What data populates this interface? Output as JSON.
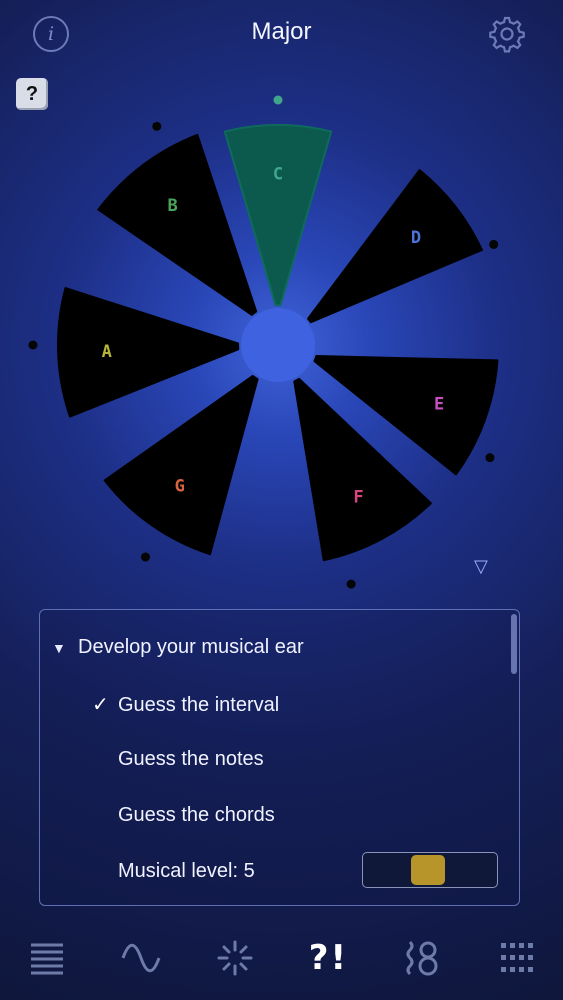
{
  "header": {
    "title": "Major",
    "info_icon_glyph": "i",
    "help_glyph": "?"
  },
  "wheel": {
    "notes": [
      {
        "label": "C",
        "color": "#3fa68c",
        "selected": true,
        "fill": "#0c5a4d"
      },
      {
        "label": "D",
        "color": "#4b73d9",
        "selected": false
      },
      {
        "label": "E",
        "color": "#c94fc0",
        "selected": false
      },
      {
        "label": "F",
        "color": "#d9457f",
        "selected": false
      },
      {
        "label": "G",
        "color": "#d9643e",
        "selected": false
      },
      {
        "label": "A",
        "color": "#b8b43a",
        "selected": false
      },
      {
        "label": "B",
        "color": "#4aa35a",
        "selected": false
      }
    ]
  },
  "panel": {
    "section_title": "Develop your musical ear",
    "options": [
      {
        "label": "Guess the interval",
        "checked": true
      },
      {
        "label": "Guess the notes",
        "checked": false
      },
      {
        "label": "Guess the chords",
        "checked": false
      }
    ],
    "level_label": "Musical level: 5",
    "level_value": 5,
    "level_fraction": 0.5,
    "check_glyph": "✓",
    "section_glyph": "▼"
  },
  "collapse_glyph": "▽",
  "nav": {
    "items": [
      {
        "name": "staff-icon",
        "active": false
      },
      {
        "name": "wave-icon",
        "active": false
      },
      {
        "name": "burst-icon",
        "active": false
      },
      {
        "name": "quiz-icon",
        "label": "?!",
        "active": true
      },
      {
        "name": "tuning-icon",
        "active": false
      },
      {
        "name": "grid-icon",
        "active": false
      }
    ]
  },
  "colors": {
    "accent_gold": "#b8952a",
    "selected_teal": "#0c5a4d",
    "center": "#3f63e0"
  }
}
